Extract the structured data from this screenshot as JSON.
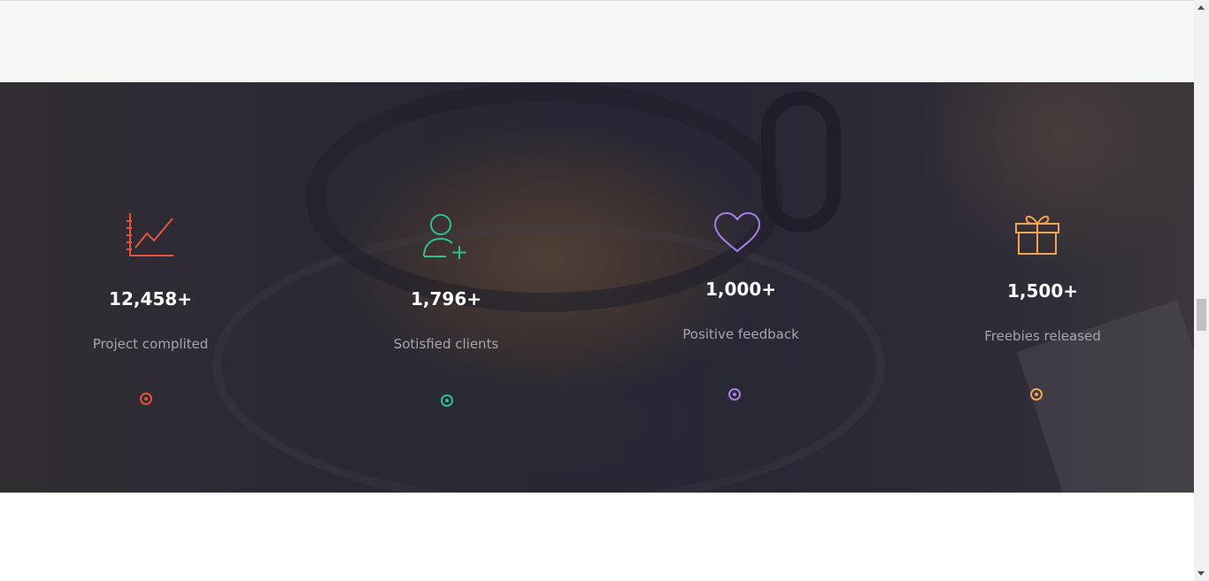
{
  "stats": [
    {
      "number": "12,458+",
      "label": "Project complited",
      "icon": "chart-line-icon",
      "color": "#e8533f"
    },
    {
      "number": "1,796+",
      "label": "Sotisfied clients",
      "icon": "user-add-icon",
      "color": "#2fc193"
    },
    {
      "number": "1,000+",
      "label": "Positive feedback",
      "icon": "heart-icon",
      "color": "#a77ee8"
    },
    {
      "number": "1,500+",
      "label": "Freebies released",
      "icon": "gift-icon",
      "color": "#f0a64a"
    }
  ]
}
